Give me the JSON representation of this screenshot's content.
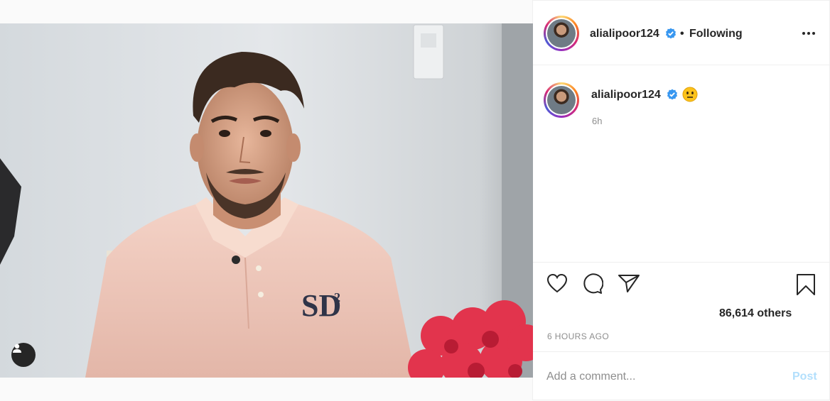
{
  "post": {
    "username": "alialipoor124",
    "follow_separator": "•",
    "follow_status": "Following",
    "caption_emoji": "😐",
    "caption_time": "6h",
    "likes_text": "86,614 others",
    "time_ago": "6 HOURS AGO",
    "comment_placeholder": "Add a comment...",
    "post_label": "Post"
  },
  "icons": {
    "like": "heart-icon",
    "comment": "comment-icon",
    "share": "send-icon",
    "save": "bookmark-icon",
    "more": "more-options-icon",
    "verified": "verified-badge-icon",
    "tag": "user-tag-icon"
  },
  "colors": {
    "verified": "#3897f0",
    "post_button_disabled": "#b2dffc",
    "muted": "#8e8e8e"
  }
}
